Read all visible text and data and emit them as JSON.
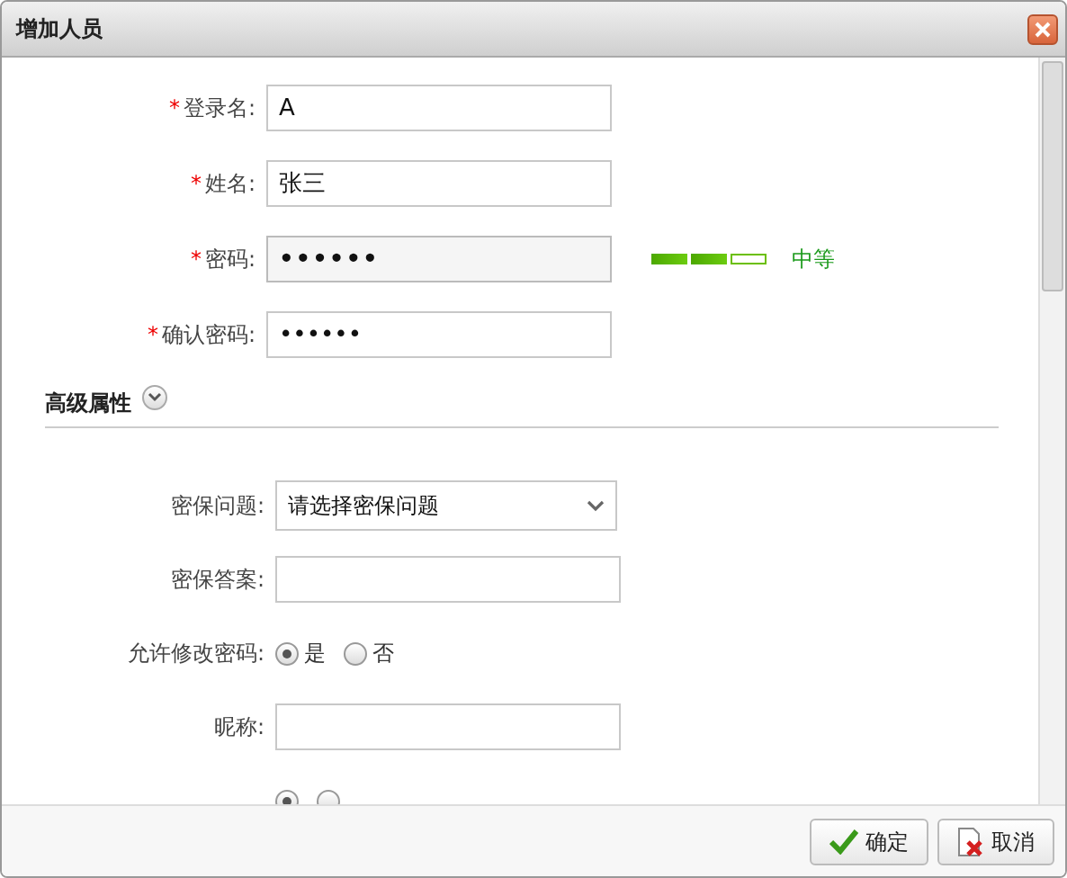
{
  "window": {
    "title": "增加人员"
  },
  "required_fields": [
    {
      "marker": "*",
      "label": "登录名:",
      "value": "A",
      "kind": "text"
    },
    {
      "marker": "*",
      "label": "姓名:",
      "value": "张三",
      "kind": "text"
    },
    {
      "marker": "*",
      "label": "密码:",
      "value": "••••••",
      "kind": "password",
      "strength": {
        "level": 0.69,
        "reading": "中等"
      }
    },
    {
      "marker": "*",
      "label": "确认密码:",
      "value": "••••••",
      "kind": "text"
    }
  ],
  "advanced": {
    "title": "高级属性",
    "expanded": true,
    "fields": [
      {
        "kind": "select",
        "label": "密保问题:",
        "value": "请选择密保问题"
      },
      {
        "kind": "text",
        "label": "密保答案:"
      },
      {
        "kind": "radio",
        "label": "允许修改密码:",
        "options": [
          {
            "label": "是",
            "selected": true
          },
          {
            "label": "否",
            "selected": false
          }
        ]
      },
      {
        "kind": "text",
        "label": "昵称:"
      },
      {
        "kind": "radio",
        "options": [
          {
            "selected": true
          },
          {
            "selected": false
          }
        ]
      }
    ]
  },
  "buttons": [
    {
      "label": "确定",
      "kind": "ok"
    },
    {
      "label": "取消",
      "kind": "cancel"
    }
  ]
}
